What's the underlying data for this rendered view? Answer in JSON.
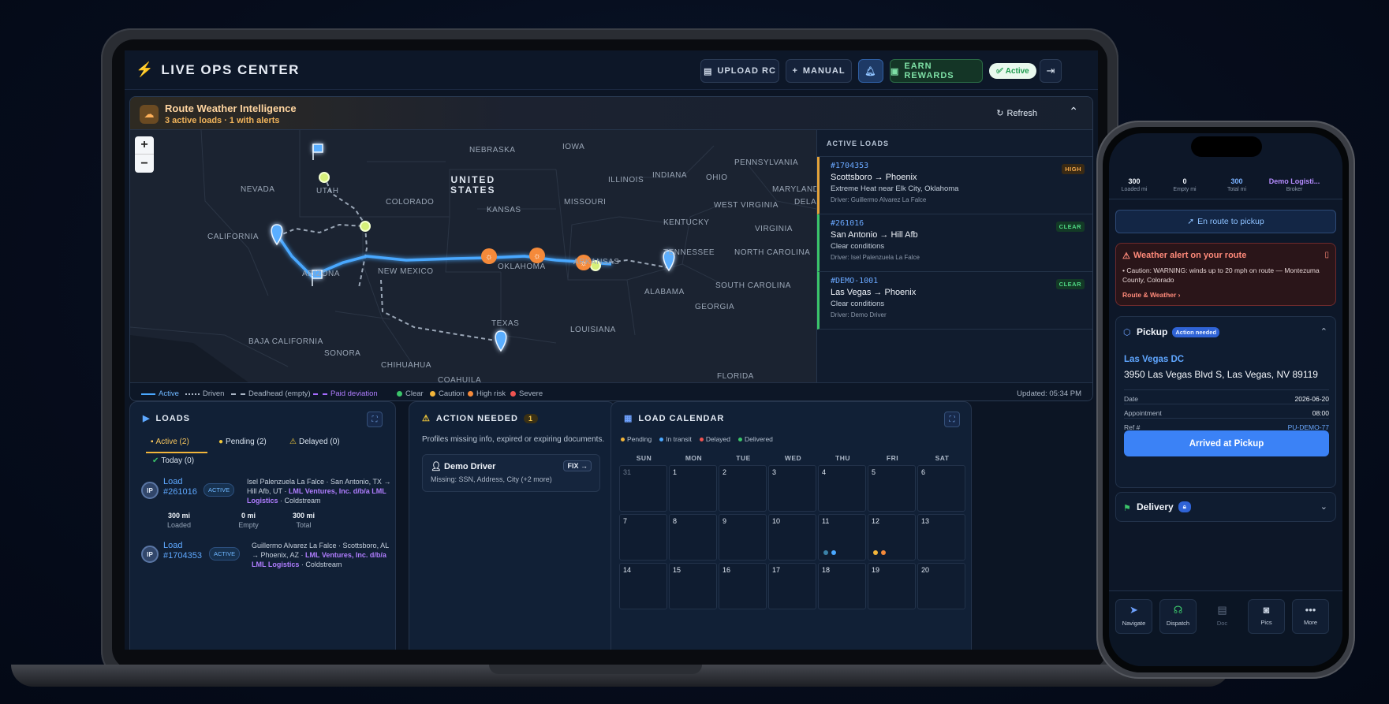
{
  "header": {
    "title": "LIVE OPS CENTER",
    "upload_label": "UPLOAD RC",
    "manual_label": "MANUAL",
    "rewards_label": "EARN REWARDS",
    "status_label": "Active"
  },
  "weather": {
    "title": "Route Weather Intelligence",
    "subtitle": "3 active loads · 1 with alerts",
    "refresh_label": "Refresh",
    "map_labels": {
      "nebraska": "NEBRASKA",
      "iowa": "IOWA",
      "pennsylvania": "PENNSYLVANIA",
      "nevada": "NEVADA",
      "utah": "UTAH",
      "united_states": "UNITED\nSTATES",
      "illinois": "ILLINOIS",
      "indiana": "INDIANA",
      "ohio": "OHIO",
      "maryland": "MARYLAND",
      "colorado": "COLORADO",
      "missouri": "MISSOURI",
      "west_virginia": "WEST VIRGINIA",
      "dela": "DELA",
      "kansas": "KANSAS",
      "california": "CALIFORNIA",
      "kentucky": "KENTUCKY",
      "virginia": "VIRGINIA",
      "arizona": "ARIZONA",
      "new_mexico": "NEW MEXICO",
      "oklahoma": "OKLAHOMA",
      "arkansas": "ARKANSAS",
      "tennessee": "TENNESSEE",
      "north_carolina": "NORTH CAROLINA",
      "alabama": "ALABAMA",
      "south_carolina": "SOUTH CAROLINA",
      "georgia": "GEORGIA",
      "texas": "TEXAS",
      "louisiana": "LOUISIANA",
      "baja_california": "BAJA CALIFORNIA",
      "sonora": "SONORA",
      "chihuahua": "CHIHUAHUA",
      "coahuila": "COAHUILA",
      "florida": "FLORIDA"
    },
    "active_loads_title": "ACTIVE LOADS",
    "active_loads": [
      {
        "id": "#1704353",
        "route": "Scottsboro → Phoenix",
        "conditions": "Extreme Heat near Elk City, Oklahoma",
        "driver": "Driver: Guillermo Alvarez La Falce",
        "badge": "HIGH"
      },
      {
        "id": "#261016",
        "route": "San Antonio → Hill Afb",
        "conditions": "Clear conditions",
        "driver": "Driver: Isel Palenzuela La Falce",
        "badge": "CLEAR"
      },
      {
        "id": "#DEMO-1001",
        "route": "Las Vegas → Phoenix",
        "conditions": "Clear conditions",
        "driver": "Driver: Demo Driver",
        "badge": "CLEAR"
      }
    ],
    "legend": {
      "active": "Active",
      "driven": "Driven",
      "deadhead": "Deadhead (empty)",
      "paid_deviation": "Paid deviation",
      "clear": "Clear",
      "caution": "Caution",
      "high_risk": "High risk",
      "severe": "Severe",
      "updated": "Updated: 05:34 PM"
    },
    "colors": {
      "active_route": "#4aa8ff",
      "clear": "#3bc46a",
      "caution": "#f2b53a",
      "high_risk": "#f58a3a",
      "severe": "#ef5350",
      "paid_deviation": "#a66bff"
    }
  },
  "loads": {
    "title": "LOADS",
    "tabs": {
      "active": "Active (2)",
      "pending": "Pending (2)",
      "delayed": "Delayed (0)",
      "today": "Today (0)"
    },
    "items": [
      {
        "avatar": "IP",
        "label": "Load #261016",
        "badge": "ACTIVE",
        "desc": "Isel Palenzuela La Falce · San Antonio, TX → Hill Afb, UT · ",
        "broker": "LML Ventures, Inc. d/b/a LML Logistics",
        "company": " · Coldstream",
        "loaded": "300 mi",
        "loaded_label": "Loaded",
        "empty": "0 mi",
        "empty_label": "Empty",
        "total": "300 mi",
        "total_label": "Total"
      },
      {
        "avatar": "IP",
        "label": "Load #1704353",
        "badge": "ACTIVE",
        "desc": "Guillermo Alvarez La Falce · Scottsboro, AL → Phoenix, AZ · ",
        "broker": "LML Ventures, Inc. d/b/a LML Logistics",
        "company": " · Coldstream"
      }
    ]
  },
  "action": {
    "title": "ACTION NEEDED",
    "count": "1",
    "description": "Profiles missing info, expired or expiring documents.",
    "driver_name": "Demo Driver",
    "missing": "Missing: SSN, Address, City (+2 more)",
    "fix_label": "FIX →"
  },
  "calendar": {
    "title": "LOAD CALENDAR",
    "legend": [
      "Pending",
      "In transit",
      "Delayed",
      "Delivered"
    ],
    "legend_colors": [
      "#f2b53a",
      "#4aa8ff",
      "#ef5350",
      "#3bc46a"
    ],
    "days_of_week": [
      "SUN",
      "MON",
      "TUE",
      "WED",
      "THU",
      "FRI",
      "SAT"
    ],
    "weeks": [
      [
        "31",
        "1",
        "2",
        "3",
        "4",
        "5",
        "6"
      ],
      [
        "7",
        "8",
        "9",
        "10",
        "11",
        "12",
        "13"
      ],
      [
        "14",
        "15",
        "16",
        "17",
        "18",
        "19",
        "20"
      ]
    ]
  },
  "phone": {
    "stats": [
      {
        "value": "300",
        "label": "Loaded mi"
      },
      {
        "value": "0",
        "label": "Empty mi"
      },
      {
        "value": "300",
        "label": "Total mi"
      },
      {
        "value": "Demo Logisti...",
        "label": "Broker"
      }
    ],
    "route_status": "En route to pickup",
    "alert_title": "Weather alert on your route",
    "alert_body": "• Caution: WARNING: winds up to 20 mph on route — Montezuma County, Colorado",
    "alert_link": "Route & Weather ›",
    "pickup": {
      "title": "Pickup",
      "badge": "Action needed",
      "place": "Las Vegas DC",
      "address": "3950 Las Vegas Blvd S, Las Vegas, NV 89119",
      "date_label": "Date",
      "date": "2026-06-20",
      "appt_label": "Appointment",
      "appt": "08:00",
      "ref_label": "Ref #",
      "ref": "PU-DEMO-77",
      "cta": "Arrived at Pickup"
    },
    "delivery": {
      "title": "Delivery"
    },
    "nav": [
      "Navigate",
      "Dispatch",
      "Doc",
      "Pics",
      "More"
    ]
  }
}
